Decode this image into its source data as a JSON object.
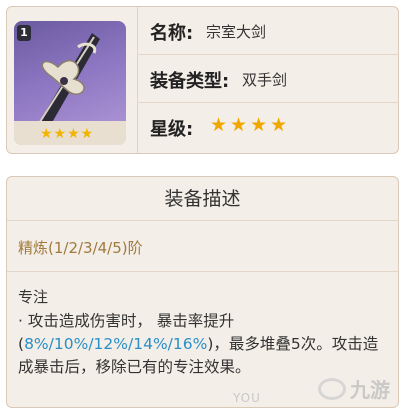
{
  "weapon": {
    "level_badge": "1",
    "thumb_stars": "★★★★",
    "name_label": "名称:",
    "name_value": "宗室大剑",
    "type_label": "装备类型:",
    "type_value": "双手剑",
    "rarity_label": "星级:",
    "rarity_stars": "★★★★",
    "rarity_count": 4
  },
  "description": {
    "header": "装备描述",
    "refinement": "精炼(1/2/3/4/5)阶",
    "skill_name": "专注",
    "text_part1": "· 攻击造成伤害时， 暴击率提升(",
    "text_highlight": "8%/10%/12%/14%/16%",
    "text_part2": ")，最多堆叠5次。攻击造成暴击后，移除已有的专注效果。"
  },
  "watermark": {
    "text": "九游",
    "sub": "YOU"
  },
  "colors": {
    "accent_blue": "#2a8fc7",
    "star_gold": "#f0a800",
    "refine_brown": "#a07a3e"
  }
}
